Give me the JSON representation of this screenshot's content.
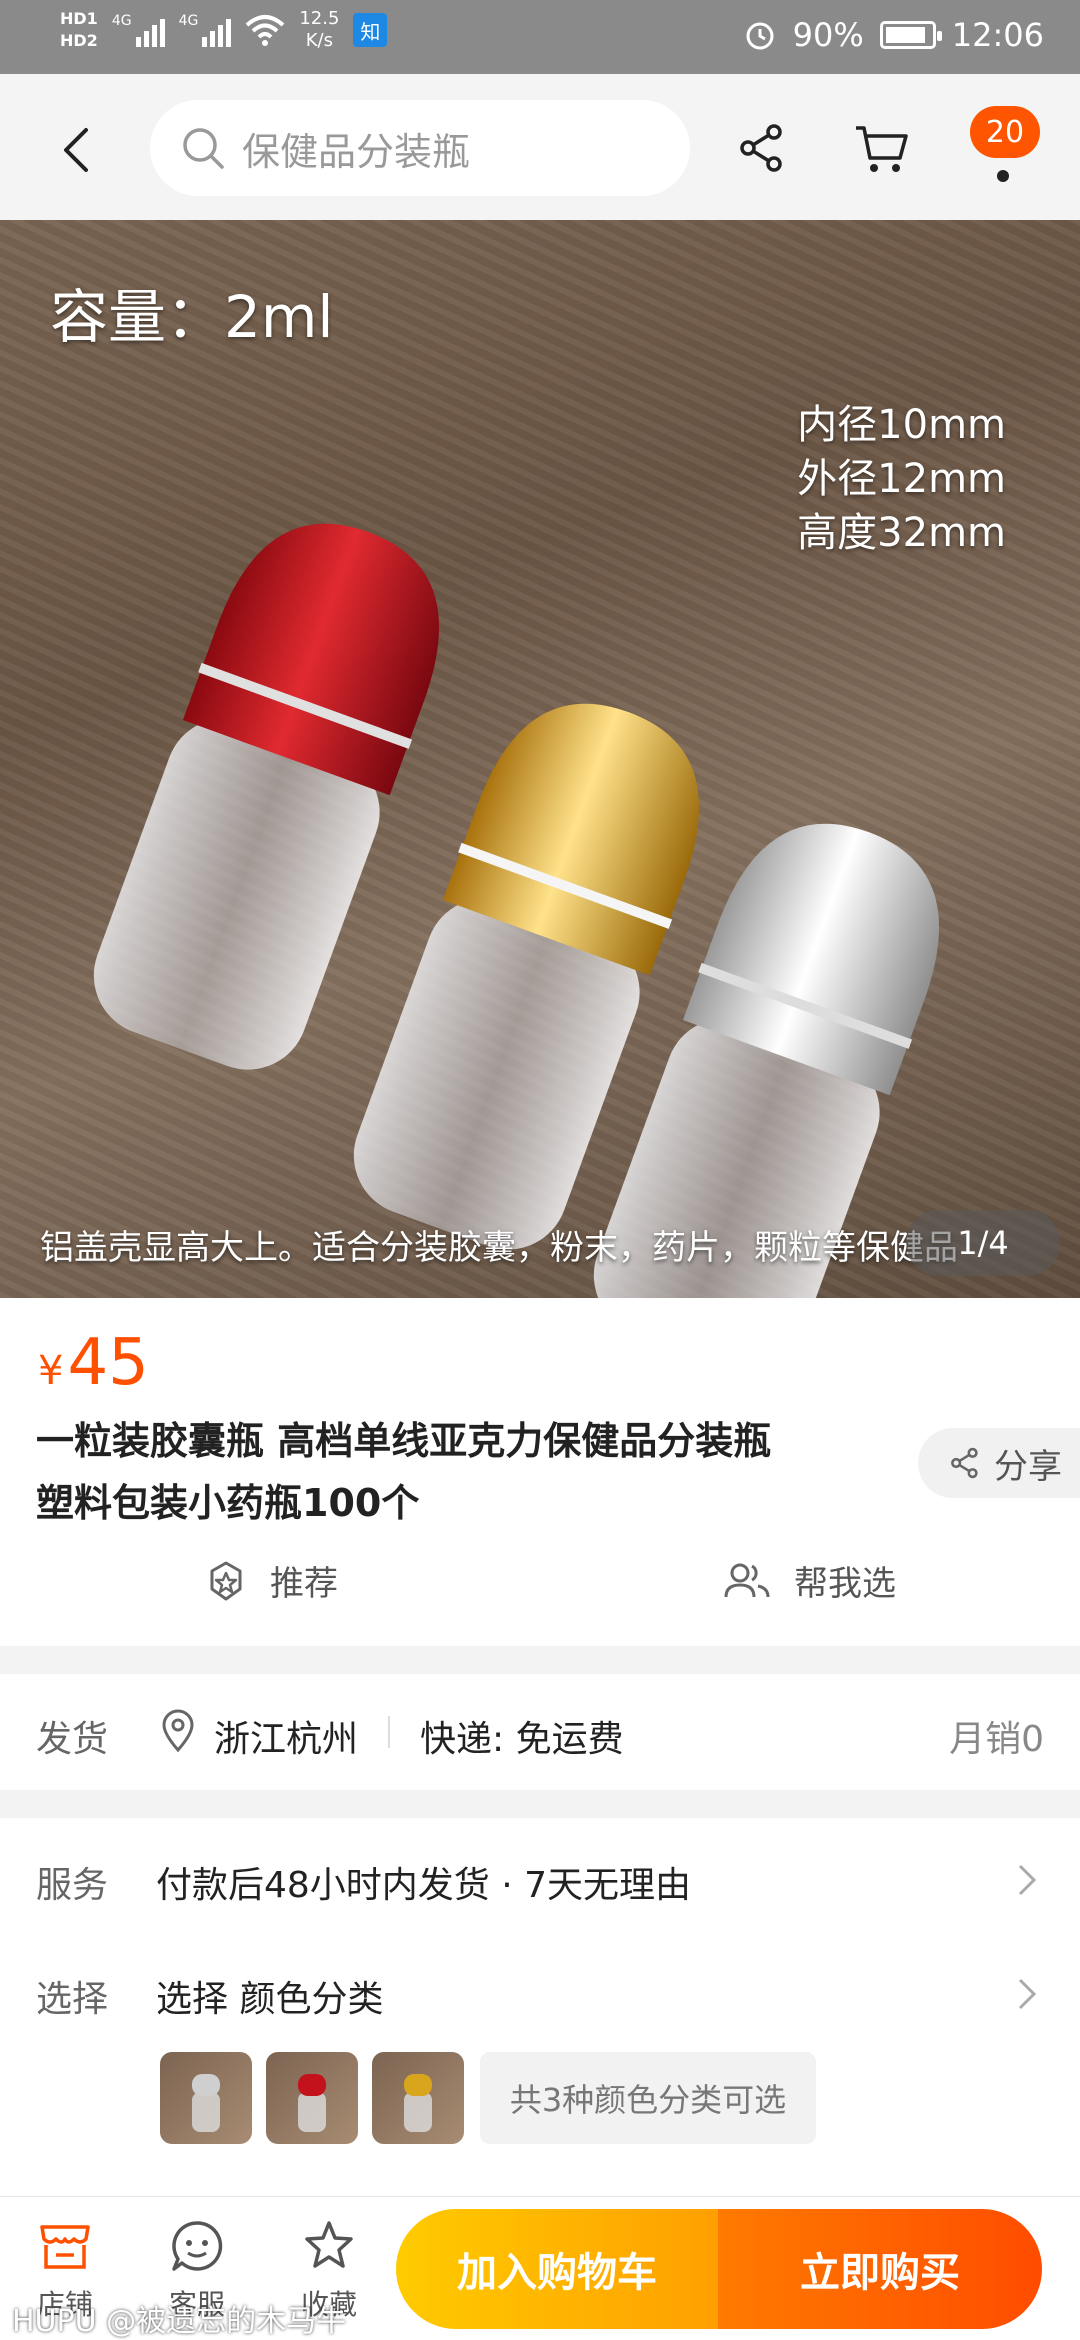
{
  "status_bar": {
    "hd1": "HD1",
    "hd2": "HD2",
    "net_type1": "4G",
    "net_type2": "4G",
    "speed_value": "12.5",
    "speed_unit": "K/s",
    "app_badge": "知",
    "battery": "90%",
    "battery_level": 0.9,
    "time": "12:06"
  },
  "top_nav": {
    "search_placeholder": "保健品分装瓶",
    "cart_count": "20"
  },
  "hero": {
    "capacity_text": "容量：2ml",
    "spec_inner": "内径10mm",
    "spec_outer": "外径12mm",
    "spec_height": "高度32mm",
    "caption": "铝盖壳显高大上。适合分装胶囊，粉末，药片，颗粒等保健品",
    "counter": "1/4",
    "cap_colors": [
      "#c4121c",
      "#d9a51c",
      "#cfcfcf"
    ]
  },
  "product": {
    "currency": "¥",
    "price": "45",
    "title_line1": "一粒装胶囊瓶 高档单线亚克力保健品分装瓶",
    "title_line2": "塑料包装小药瓶100个",
    "share_label": "分享",
    "recommend_label": "推荐",
    "help_choose_label": "帮我选"
  },
  "shipping": {
    "label": "发货",
    "location": "浙江杭州",
    "express": "快递: 免运费",
    "monthly_sales": "月销0"
  },
  "service": {
    "label": "服务",
    "text": "付款后48小时内发货 · 7天无理由"
  },
  "select": {
    "label": "选择",
    "text": "选择 颜色分类",
    "more_variants": "共3种颜色分类可选"
  },
  "bottom_bar": {
    "shop": "店铺",
    "service": "客服",
    "favorite": "收藏",
    "add_to_cart": "加入购物车",
    "buy_now": "立即购买"
  },
  "colors": {
    "accent": "#ff5000",
    "cart_button": "#ffb400",
    "buy_button": "#ff5a00"
  },
  "watermark": "HUPU @被遗忘的木马牛"
}
